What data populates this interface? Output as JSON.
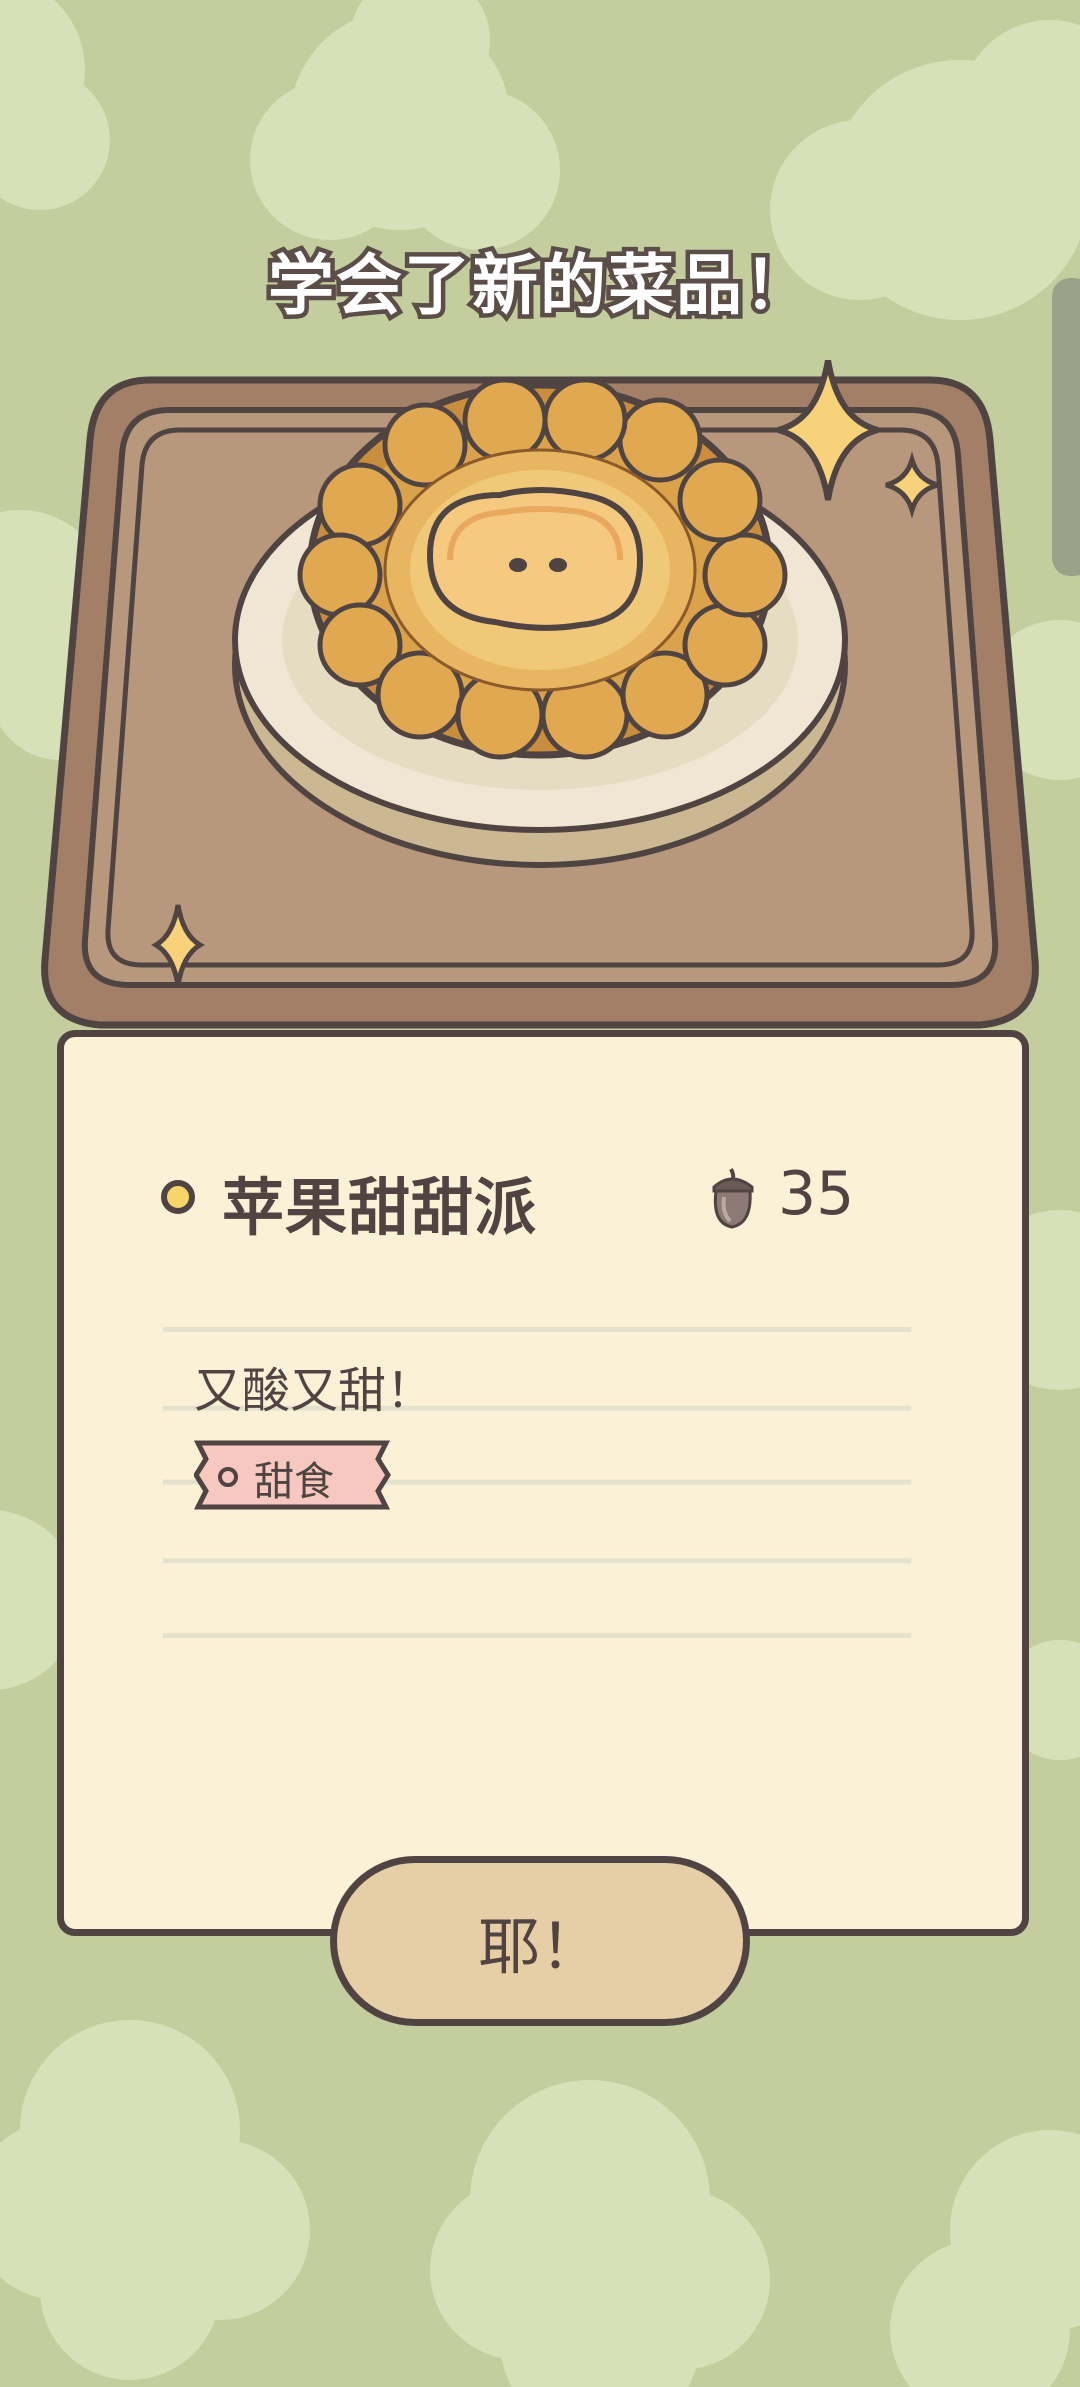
{
  "header": {
    "title": "学会了新的菜品！"
  },
  "dish": {
    "name": "苹果甜甜派",
    "price": "35",
    "description": "又酸又甜！",
    "tag": "甜食",
    "price_icon": "acorn-icon",
    "image": "apple-pie-on-plate"
  },
  "actions": {
    "confirm_label": "耶！"
  },
  "colors": {
    "background": "#c3cd9e",
    "card": "#fbf1d6",
    "outline": "#4f4442",
    "tray": "#b08c70",
    "button": "#e6cfa6",
    "tag": "#f6c8c0"
  }
}
